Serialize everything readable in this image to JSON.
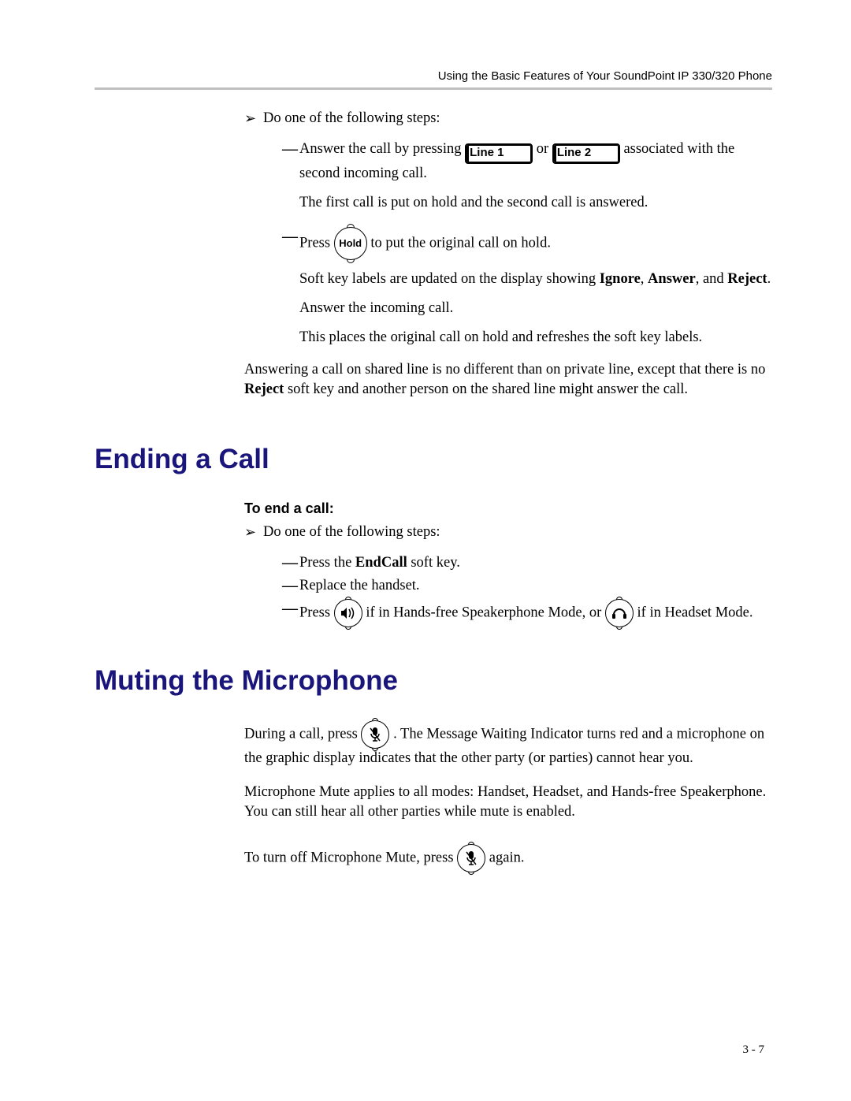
{
  "header": "Using the Basic Features of Your SoundPoint IP 330/320 Phone",
  "body": {
    "step_intro": "Do one of the following steps:",
    "answer_call_prefix": "Answer the call by pressing ",
    "line1_label": "Line 1",
    "or_word": " or ",
    "line2_label": "Line 2",
    "answer_call_suffix": " associated with the second incoming call.",
    "first_call_hold": "The first call is put on hold and the second call is answered.",
    "press_word": "Press ",
    "hold_label": "Hold",
    "hold_suffix": " to put the original call on hold.",
    "softkey_update_prefix": "Soft key labels are updated on the display showing ",
    "ignore": "Ignore",
    "comma_sp": ", ",
    "answer": "Answer",
    "and_sp": ", and ",
    "reject": "Reject",
    "period": ".",
    "answer_incoming": "Answer the incoming call.",
    "places_hold": "This places the original call on hold and refreshes the soft key labels.",
    "shared_line_p1": "Answering a call on shared line is no different than on private line, except that there is no ",
    "shared_line_p2": " soft key and another person on the shared line might answer the call."
  },
  "ending": {
    "heading": "Ending a Call",
    "subhead": "To end a call:",
    "step_intro": "Do one of the following steps:",
    "opt1_prefix": "Press the ",
    "endcall": "EndCall",
    "opt1_suffix": " soft key.",
    "opt2": "Replace the handset.",
    "opt3_prefix": "Press ",
    "opt3_mid": " if in Hands-free Speakerphone Mode, or ",
    "opt3_suffix": " if in Headset Mode."
  },
  "muting": {
    "heading": "Muting the Microphone",
    "p1_prefix": "During a call, press ",
    "p1_suffix": " . The Message Waiting Indicator turns red and a microphone on the graphic display indicates that the other party (or parties) cannot hear you.",
    "p2": "Microphone Mute applies to all modes: Handset, Headset, and Hands-free Speakerphone. You can still hear all other parties while mute is enabled.",
    "p3_prefix": "To turn off Microphone Mute, press ",
    "p3_suffix": " again."
  },
  "footer": "3 - 7"
}
